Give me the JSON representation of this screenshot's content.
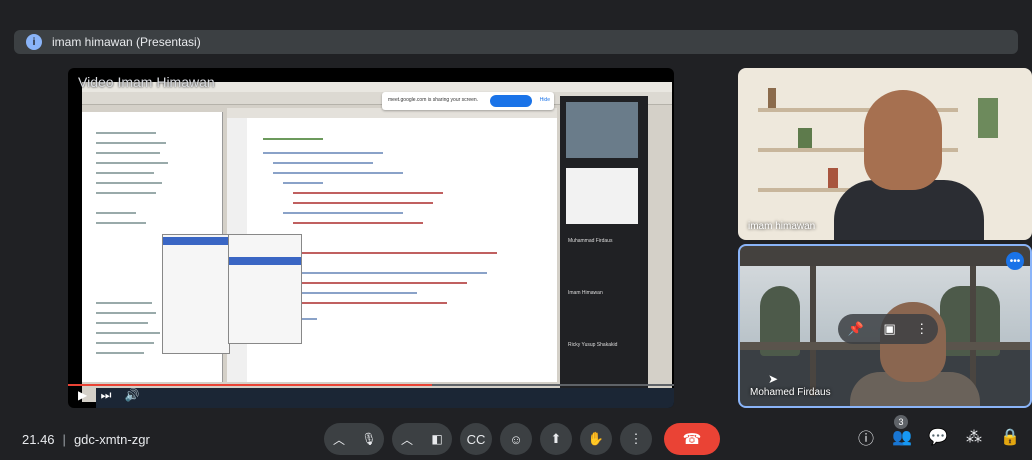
{
  "header": {
    "badge": "i",
    "title": "imam himawan (Presentasi)"
  },
  "presentation": {
    "title": "Video Imam Himawan",
    "share_text": "meet.google.com is sharing your screen.",
    "share_stop": "Stop sharing",
    "share_hide": "Hide",
    "mini_names": [
      "Muhammad Firdaus",
      "Imam Himawan",
      "Ricky Yusup Shakakid"
    ]
  },
  "tiles": [
    {
      "name": "imam himawan"
    },
    {
      "name": "Mohamed Firdaus"
    }
  ],
  "bottom": {
    "time": "21.46",
    "meeting_code": "gdc-xmtn-zgr",
    "participants_count": "3"
  },
  "icons": {
    "mic": "microphone-icon",
    "camera": "camera-icon",
    "captions": "captions-icon",
    "emoji": "emoji-icon",
    "present": "present-icon",
    "hand": "raise-hand-icon",
    "more": "more-vert-icon",
    "end": "end-call-icon",
    "info": "info-icon",
    "people": "people-icon",
    "chat": "chat-icon",
    "activities": "activities-icon",
    "lock": "host-controls-icon"
  },
  "colors": {
    "end_call": "#ea4335",
    "accent": "#1a73e8"
  },
  "video_progress": 0.6
}
